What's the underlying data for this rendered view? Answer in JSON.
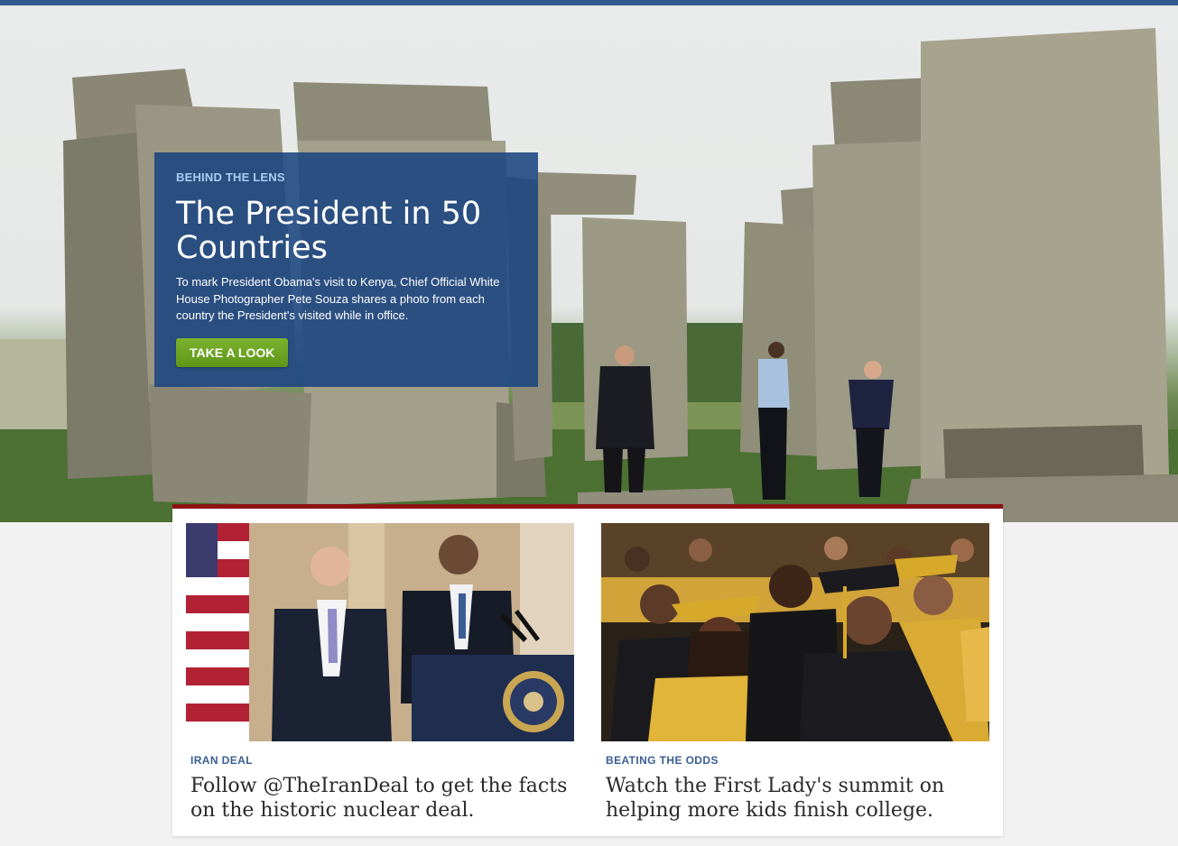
{
  "hero": {
    "eyebrow": "BEHIND THE LENS",
    "title": "The President in 50 Countries",
    "description": "To mark President Obama's visit to Kenya, Chief Official White House Photographer Pete Souza shares a photo from each country the President's visited while in office.",
    "cta_label": "TAKE A LOOK"
  },
  "features": [
    {
      "eyebrow": "IRAN DEAL",
      "headline": "Follow @TheIranDeal to get the facts on the historic nuclear deal."
    },
    {
      "eyebrow": "BEATING THE ODDS",
      "headline": "Watch the First Lady's summit on helping more kids finish college."
    }
  ],
  "colors": {
    "top_bar": "#31598f",
    "hero_panel": "#1a4480",
    "cta": "#6aa321",
    "strip_border": "#8e1313",
    "eyebrow": "#3b5e93"
  }
}
